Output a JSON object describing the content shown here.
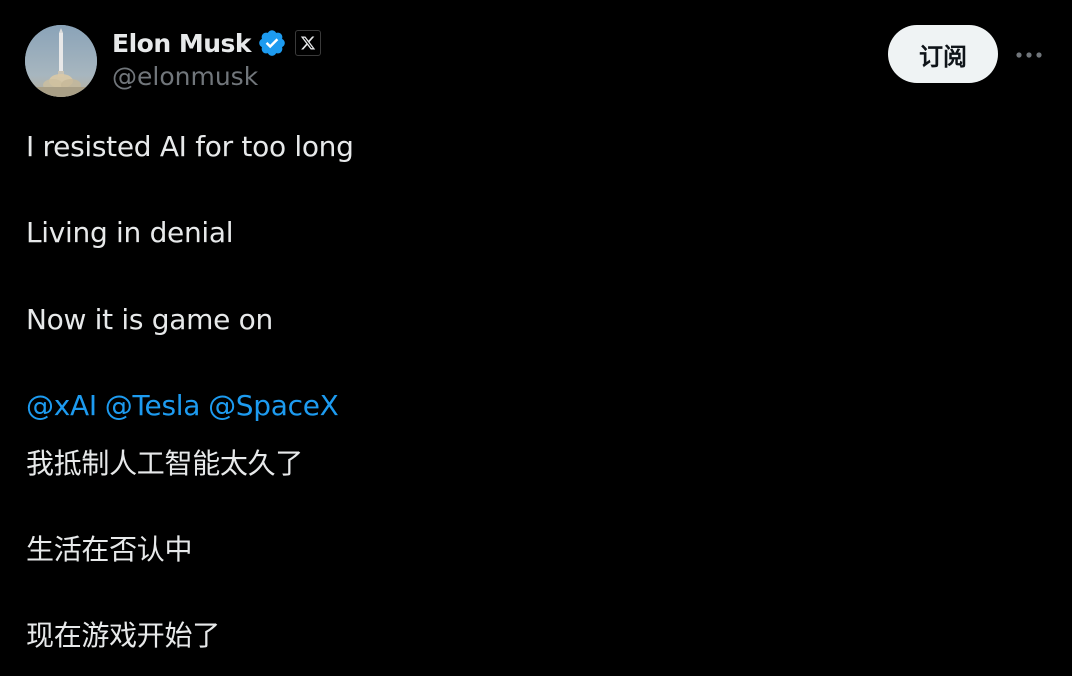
{
  "author": {
    "display_name": "Elon Musk",
    "handle": "@elonmusk",
    "verified_icon": "verified-badge-icon",
    "affiliate_icon": "x-logo-icon"
  },
  "actions": {
    "subscribe_label": "订阅",
    "more_icon": "more-horizontal-icon"
  },
  "tweet": {
    "lines_en": [
      "I resisted AI for too long",
      "Living in denial",
      "Now it is game on"
    ],
    "mentions": [
      "@xAI",
      "@Tesla",
      "@SpaceX"
    ],
    "lines_zh": [
      "我抵制人工智能太久了",
      "生活在否认中",
      "现在游戏开始了"
    ]
  },
  "colors": {
    "background": "#000000",
    "text": "#e7e9ea",
    "secondary_text": "#71767b",
    "link": "#1d9bf0",
    "verified": "#1d9bf0",
    "button_bg": "#eff3f4"
  }
}
